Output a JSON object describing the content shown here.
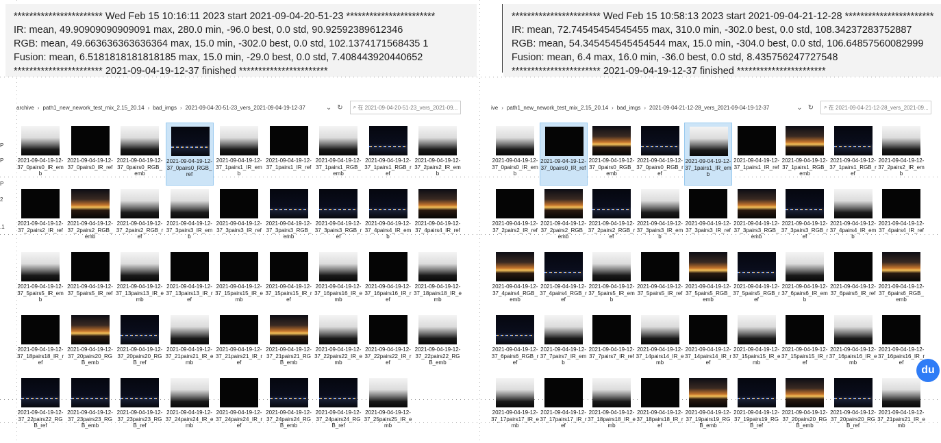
{
  "log_left": {
    "lines": [
      "*********************** Wed Feb 15 10:16:11 2023 start 2021-09-04-20-51-23 ***********************",
      "IR: mean, 49.90909090909091 max, 280.0 min, -96.0 best, 0.0 std, 90.92592389612346",
      "RGB:  mean, 49.663636363636364 max, 15.0 min, -302.0 best, 0.0 std, 102.1374171568435 1",
      "Fusion:  mean, 6.5181818181818185 max, 15.0 min, -29.0 best, 0.0 std, 7.408443920440652",
      "*********************** 2021-09-04-19-12-37 finished ***********************"
    ]
  },
  "log_right": {
    "lines": [
      "*********************** Wed Feb 15 10:58:13 2023 start 2021-09-04-21-12-28 ***********************",
      "IR: mean, 72.74545454545455 max, 310.0 min, -302.0 best, 0.0 std, 108.34237283752887",
      "RGB:  mean, 54.345454545454544 max, 15.0 min, -304.0 best, 0.0 std, 106.64857560082999",
      "Fusion:  mean, 6.4 max, 16.0 min, -36.0 best, 0.0 std, 8.435756247727548",
      "*********************** 2021-09-04-19-12-37 finished ***********************"
    ]
  },
  "explorer_left": {
    "breadcrumb": [
      "archive",
      "path1_new_nework_test_mix_2.15_20.14",
      "bad_imgs",
      "2021-09-04-20-51-23_vers_2021-09-04-19-12-37"
    ],
    "search_placeholder": "在 2021-09-04-20-51-23_vers_2021-09...",
    "side_labels": [
      "P",
      "P",
      "P",
      "2",
      ".1"
    ],
    "files": [
      {
        "name": "2021-09-04-19-12-37_0pairs0_IR_emb",
        "kind": "ir"
      },
      {
        "name": "2021-09-04-19-12-37_0pairs0_IR_ref",
        "kind": "dark"
      },
      {
        "name": "2021-09-04-19-12-37_0pairs0_RGB_emb",
        "kind": "ir"
      },
      {
        "name": "2021-09-04-19-12-37_0pairs0_RGB_ref",
        "kind": "rgb",
        "selected": true
      },
      {
        "name": "2021-09-04-19-12-37_1pairs1_IR_emb",
        "kind": "ir"
      },
      {
        "name": "2021-09-04-19-12-37_1pairs1_IR_ref",
        "kind": "dark"
      },
      {
        "name": "2021-09-04-19-12-37_1pairs1_RGB_emb",
        "kind": "ir"
      },
      {
        "name": "2021-09-04-19-12-37_1pairs1_RGB_ref",
        "kind": "rgb"
      },
      {
        "name": "2021-09-04-19-12-37_2pairs2_IR_emb",
        "kind": "ir"
      },
      {
        "name": "2021-09-04-19-12-37_2pairs2_IR_ref",
        "kind": "dark"
      },
      {
        "name": "2021-09-04-19-12-37_2pairs2_RGB_emb",
        "kind": "sun"
      },
      {
        "name": "2021-09-04-19-12-37_2pairs2_RGB_ref",
        "kind": "ir"
      },
      {
        "name": "2021-09-04-19-12-37_3pairs3_IR_emb",
        "kind": "ir"
      },
      {
        "name": "2021-09-04-19-12-37_3pairs3_IR_ref",
        "kind": "dark"
      },
      {
        "name": "2021-09-04-19-12-37_3pairs3_RGB_emb",
        "kind": "rgb"
      },
      {
        "name": "2021-09-04-19-12-37_3pairs3_RGB_ref",
        "kind": "rgb"
      },
      {
        "name": "2021-09-04-19-12-37_4pairs4_IR_emb",
        "kind": "rgb"
      },
      {
        "name": "2021-09-04-19-12-37_4pairs4_IR_ref",
        "kind": "sun"
      },
      {
        "name": "2021-09-04-19-12-37_5pairs5_IR_emb",
        "kind": "ir"
      },
      {
        "name": "2021-09-04-19-12-37_5pairs5_IR_ref",
        "kind": "dark"
      },
      {
        "name": "2021-09-04-19-12-37_13pairs13_IR_emb",
        "kind": "ir"
      },
      {
        "name": "2021-09-04-19-12-37_13pairs13_IR_ref",
        "kind": "dark"
      },
      {
        "name": "2021-09-04-19-12-37_15pairs15_IR_emb",
        "kind": "dark"
      },
      {
        "name": "2021-09-04-19-12-37_15pairs15_IR_ref",
        "kind": "dark"
      },
      {
        "name": "2021-09-04-19-12-37_16pairs16_IR_emb",
        "kind": "ir"
      },
      {
        "name": "2021-09-04-19-12-37_16pairs16_IR_ref",
        "kind": "dark"
      },
      {
        "name": "2021-09-04-19-12-37_18pairs18_IR_emb",
        "kind": "ir"
      },
      {
        "name": "2021-09-04-19-12-37_18pairs18_IR_ref",
        "kind": "dark"
      },
      {
        "name": "2021-09-04-19-12-37_20pairs20_RGB_emb",
        "kind": "sun"
      },
      {
        "name": "2021-09-04-19-12-37_20pairs20_RGB_ref",
        "kind": "rgb"
      },
      {
        "name": "2021-09-04-19-12-37_21pairs21_IR_emb",
        "kind": "ir"
      },
      {
        "name": "2021-09-04-19-12-37_21pairs21_IR_ref",
        "kind": "dark"
      },
      {
        "name": "2021-09-04-19-12-37_21pairs21_RGB_emb",
        "kind": "sun"
      },
      {
        "name": "2021-09-04-19-12-37_22pairs22_IR_emb",
        "kind": "ir"
      },
      {
        "name": "2021-09-04-19-12-37_22pairs22_IR_ref",
        "kind": "dark"
      },
      {
        "name": "2021-09-04-19-12-37_22pairs22_RGB_emb",
        "kind": "ir"
      },
      {
        "name": "2021-09-04-19-12-37_22pairs22_RGB_ref",
        "kind": "rgb"
      },
      {
        "name": "2021-09-04-19-12-37_23pairs23_RGB_emb",
        "kind": "rgb"
      },
      {
        "name": "2021-09-04-19-12-37_23pairs23_RGB_ref",
        "kind": "rgb"
      },
      {
        "name": "2021-09-04-19-12-37_24pairs24_IR_emb",
        "kind": "ir"
      },
      {
        "name": "2021-09-04-19-12-37_24pairs24_IR_ref",
        "kind": "dark"
      },
      {
        "name": "2021-09-04-19-12-37_24pairs24_RGB_emb",
        "kind": "rgb"
      },
      {
        "name": "2021-09-04-19-12-37_24pairs24_RGB_ref",
        "kind": "rgb"
      },
      {
        "name": "2021-09-04-19-12-37_25pairs25_IR_emb",
        "kind": "ir"
      }
    ]
  },
  "explorer_right": {
    "breadcrumb": [
      "ive",
      "path1_new_nework_test_mix_2.15_20.14",
      "bad_imgs",
      "2021-09-04-21-12-28_vers_2021-09-04-19-12-37"
    ],
    "search_placeholder": "在 2021-09-04-21-12-28_vers_2021-09...",
    "files": [
      {
        "name": "2021-09-04-19-12-37_0pairs0_IR_emb",
        "kind": "ir"
      },
      {
        "name": "2021-09-04-19-12-37_0pairs0_IR_ref",
        "kind": "dark",
        "selected": true
      },
      {
        "name": "2021-09-04-19-12-37_0pairs0_RGB_emb",
        "kind": "sun"
      },
      {
        "name": "2021-09-04-19-12-37_0pairs0_RGB_ref",
        "kind": "rgb"
      },
      {
        "name": "2021-09-04-19-12-37_1pairs1_IR_emb",
        "kind": "ir",
        "selected": true
      },
      {
        "name": "2021-09-04-19-12-37_1pairs1_IR_ref",
        "kind": "dark"
      },
      {
        "name": "2021-09-04-19-12-37_1pairs1_RGB_emb",
        "kind": "sun"
      },
      {
        "name": "2021-09-04-19-12-37_1pairs1_RGB_ref",
        "kind": "rgb"
      },
      {
        "name": "2021-09-04-19-12-37_2pairs2_IR_emb",
        "kind": "ir"
      },
      {
        "name": "2021-09-04-19-12-37_2pairs2_IR_ref",
        "kind": "dark"
      },
      {
        "name": "2021-09-04-19-12-37_2pairs2_RGB_emb",
        "kind": "sun"
      },
      {
        "name": "2021-09-04-19-12-37_2pairs2_RGB_ref",
        "kind": "rgb"
      },
      {
        "name": "2021-09-04-19-12-37_3pairs3_IR_emb",
        "kind": "ir"
      },
      {
        "name": "2021-09-04-19-12-37_3pairs3_IR_ref",
        "kind": "dark"
      },
      {
        "name": "2021-09-04-19-12-37_3pairs3_RGB_emb",
        "kind": "sun"
      },
      {
        "name": "2021-09-04-19-12-37_3pairs3_RGB_ref",
        "kind": "rgb"
      },
      {
        "name": "2021-09-04-19-12-37_4pairs4_IR_emb",
        "kind": "ir"
      },
      {
        "name": "2021-09-04-19-12-37_4pairs4_IR_ref",
        "kind": "dark"
      },
      {
        "name": "2021-09-04-19-12-37_4pairs4_RGB_emb",
        "kind": "sun"
      },
      {
        "name": "2021-09-04-19-12-37_4pairs4_RGB_ref",
        "kind": "rgb"
      },
      {
        "name": "2021-09-04-19-12-37_5pairs5_IR_emb",
        "kind": "ir"
      },
      {
        "name": "2021-09-04-19-12-37_5pairs5_IR_ref",
        "kind": "dark"
      },
      {
        "name": "2021-09-04-19-12-37_5pairs5_RGB_emb",
        "kind": "sun"
      },
      {
        "name": "2021-09-04-19-12-37_5pairs5_RGB_ref",
        "kind": "rgb"
      },
      {
        "name": "2021-09-04-19-12-37_6pairs6_IR_emb",
        "kind": "ir"
      },
      {
        "name": "2021-09-04-19-12-37_6pairs6_IR_ref",
        "kind": "dark"
      },
      {
        "name": "2021-09-04-19-12-37_6pairs6_RGB_emb",
        "kind": "sun"
      },
      {
        "name": "2021-09-04-19-12-37_6pairs6_RGB_ref",
        "kind": "rgb"
      },
      {
        "name": "2021-09-04-19-12-37_7pairs7_IR_emb",
        "kind": "ir"
      },
      {
        "name": "2021-09-04-19-12-37_7pairs7_IR_ref",
        "kind": "dark"
      },
      {
        "name": "2021-09-04-19-12-37_14pairs14_IR_emb",
        "kind": "ir"
      },
      {
        "name": "2021-09-04-19-12-37_14pairs14_IR_ref",
        "kind": "dark"
      },
      {
        "name": "2021-09-04-19-12-37_15pairs15_IR_emb",
        "kind": "ir"
      },
      {
        "name": "2021-09-04-19-12-37_15pairs15_IR_ref",
        "kind": "dark"
      },
      {
        "name": "2021-09-04-19-12-37_16pairs16_IR_emb",
        "kind": "ir"
      },
      {
        "name": "2021-09-04-19-12-37_16pairs16_IR_ref",
        "kind": "dark"
      },
      {
        "name": "2021-09-04-19-12-37_17pairs17_IR_emb",
        "kind": "ir"
      },
      {
        "name": "2021-09-04-19-12-37_17pairs17_IR_ref",
        "kind": "dark"
      },
      {
        "name": "2021-09-04-19-12-37_18pairs18_IR_emb",
        "kind": "ir"
      },
      {
        "name": "2021-09-04-19-12-37_18pairs18_IR_ref",
        "kind": "dark"
      },
      {
        "name": "2021-09-04-19-12-37_19pairs19_RGB_emb",
        "kind": "sun"
      },
      {
        "name": "2021-09-04-19-12-37_19pairs19_RGB_ref",
        "kind": "rgb"
      },
      {
        "name": "2021-09-04-19-12-37_20pairs20_RGB_emb",
        "kind": "sun"
      },
      {
        "name": "2021-09-04-19-12-37_20pairs20_RGB_ref",
        "kind": "rgb"
      },
      {
        "name": "2021-09-04-19-12-37_21pairs21_IR_emb",
        "kind": "ir"
      }
    ]
  },
  "badge": {
    "label": "du",
    "color": "#2f7cf6"
  },
  "icons": {
    "refresh": "refresh-icon",
    "dropdown": "chevron-down-icon",
    "search": "search-icon"
  }
}
